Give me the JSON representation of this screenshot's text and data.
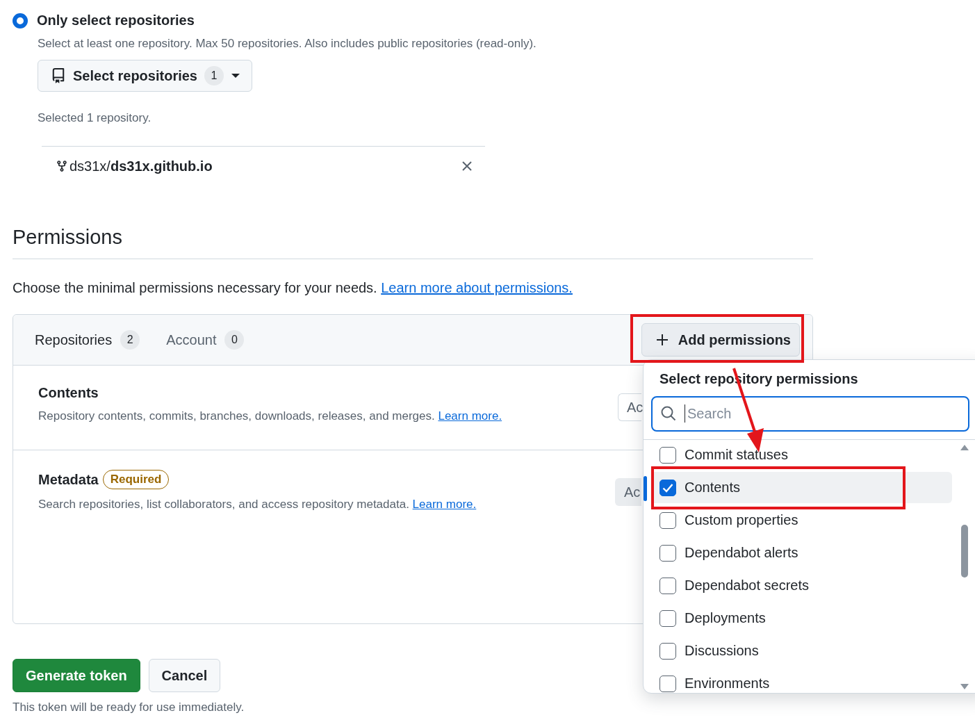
{
  "repository_access": {
    "option": {
      "label": "Only select repositories",
      "selected": true
    },
    "hint": "Select at least one repository. Max 50 repositories. Also includes public repositories (read-only).",
    "select_button": {
      "label": "Select repositories",
      "count": "1"
    },
    "selected_summary": "Selected 1 repository.",
    "repositories": [
      {
        "owner": "ds31x/",
        "name": "ds31x.github.io"
      }
    ]
  },
  "permissions": {
    "heading": "Permissions",
    "intro": "Choose the minimal permissions necessary for your needs.",
    "intro_link": "Learn more about permissions.",
    "tabs": [
      {
        "label": "Repositories",
        "count": "2",
        "selected": true
      },
      {
        "label": "Account",
        "count": "0",
        "selected": false
      }
    ],
    "add_button": "Add permissions",
    "rows": [
      {
        "name": "Contents",
        "description": "Repository contents, commits, branches, downloads, releases, and merges.",
        "link": "Learn more.",
        "access_button": {
          "label": "Ac",
          "disabled": false
        }
      },
      {
        "name": "Metadata",
        "badge": "Required",
        "description": "Search repositories, list collaborators, and access repository metadata.",
        "link": "Learn more.",
        "access_button": {
          "label": "Ac",
          "disabled": true
        }
      }
    ]
  },
  "permission_menu": {
    "title": "Select repository permissions",
    "search_placeholder": "Search",
    "items": [
      {
        "label": "Commit statuses",
        "checked": false,
        "active": false
      },
      {
        "label": "Contents",
        "checked": true,
        "active": true
      },
      {
        "label": "Custom properties",
        "checked": false,
        "active": false
      },
      {
        "label": "Dependabot alerts",
        "checked": false,
        "active": false
      },
      {
        "label": "Dependabot secrets",
        "checked": false,
        "active": false
      },
      {
        "label": "Deployments",
        "checked": false,
        "active": false
      },
      {
        "label": "Discussions",
        "checked": false,
        "active": false
      },
      {
        "label": "Environments",
        "checked": false,
        "active": false
      }
    ]
  },
  "actions": {
    "primary": "Generate token",
    "secondary": "Cancel",
    "note": "This token will be ready for use immediately."
  },
  "annotations": [
    {
      "kind": "rect"
    },
    {
      "kind": "rect"
    },
    {
      "kind": "arrow"
    }
  ]
}
